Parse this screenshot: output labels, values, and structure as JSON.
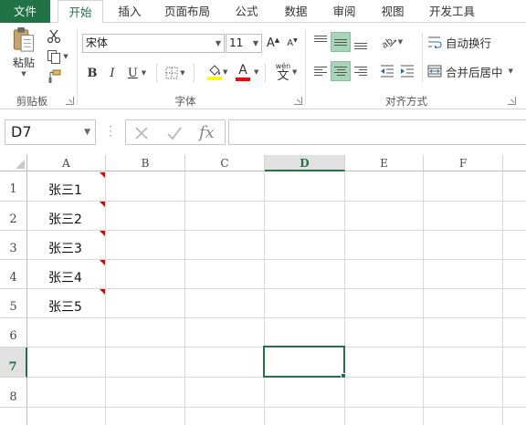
{
  "tabs": [
    "文件",
    "开始",
    "插入",
    "页面布局",
    "公式",
    "数据",
    "审阅",
    "视图",
    "开发工具"
  ],
  "active_tab": "开始",
  "clipboard": {
    "paste_label": "粘贴",
    "group_label": "剪贴板",
    "icons": [
      "clipboard-icon",
      "cut-icon",
      "copy-icon",
      "format-painter-icon"
    ]
  },
  "font": {
    "name": "宋体",
    "size": "11",
    "group_label": "字体",
    "grow_label": "A",
    "shrink_label": "A",
    "bold": "B",
    "italic": "I",
    "underline": "U",
    "font_color_label": "A",
    "phonetic_top": "wén",
    "phonetic_bottom": "文",
    "fill_color": "#ffff00",
    "font_color": "#ff0000"
  },
  "alignment": {
    "group_label": "对齐方式",
    "wrap_label": "自动换行",
    "merge_label": "合并后居中"
  },
  "formula_bar": {
    "name_box": "D7",
    "fx": "fx",
    "formula": ""
  },
  "sheet": {
    "columns": [
      "A",
      "B",
      "C",
      "D",
      "E",
      "F"
    ],
    "rows": [
      "1",
      "2",
      "3",
      "4",
      "5",
      "6",
      "7",
      "8"
    ],
    "selected_cell": "D7",
    "cells": [
      {
        "ref": "A1",
        "value": "张三1",
        "has_comment": true
      },
      {
        "ref": "A2",
        "value": "张三2",
        "has_comment": true
      },
      {
        "ref": "A3",
        "value": "张三3",
        "has_comment": true
      },
      {
        "ref": "A4",
        "value": "张三4",
        "has_comment": true
      },
      {
        "ref": "A5",
        "value": "张三5",
        "has_comment": true
      }
    ]
  },
  "colors": {
    "accent": "#217346",
    "comment_marker": "#e00000",
    "active_align_fill": "#a8d5b8"
  }
}
